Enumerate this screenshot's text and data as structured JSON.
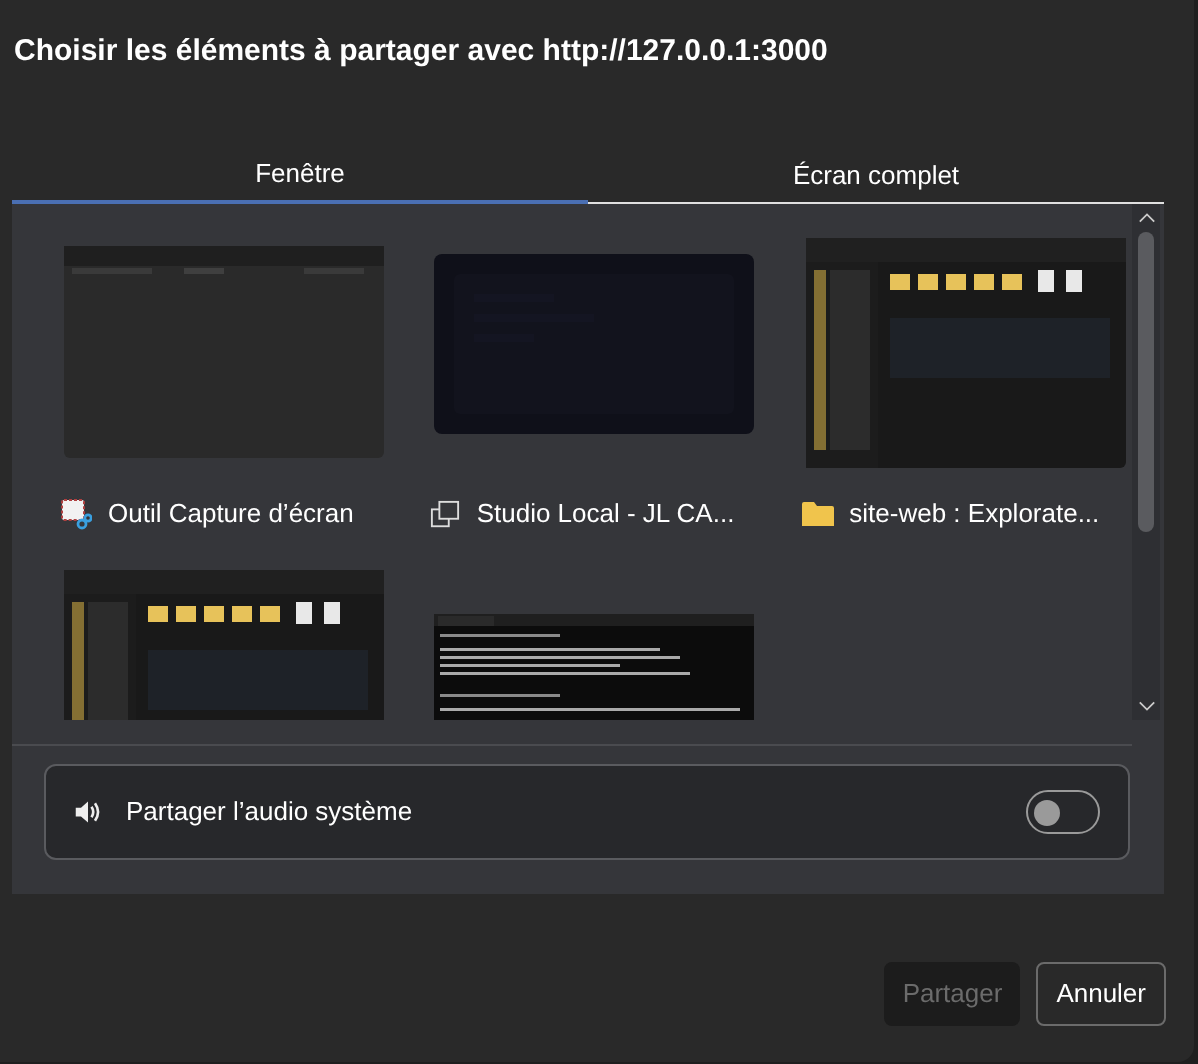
{
  "dialog": {
    "title": "Choisir les éléments à partager avec http://127.0.0.1:3000"
  },
  "tabs": [
    {
      "label": "Fenêtre",
      "selected": true
    },
    {
      "label": "Écran complet",
      "selected": false
    }
  ],
  "sources": [
    {
      "label": "Outil Capture d’écran",
      "kind": "snip",
      "selected": false
    },
    {
      "label": "Studio Local - JL CA...",
      "kind": "window",
      "selected": false
    },
    {
      "label": "site-web : Explorate...",
      "kind": "folder",
      "selected": false
    },
    {
      "kind": "explorer",
      "selected": false
    },
    {
      "kind": "terminal",
      "selected": false
    }
  ],
  "audio": {
    "label": "Partager l’audio système",
    "on": false
  },
  "buttons": [
    {
      "label": "Partager",
      "disabled": true
    },
    {
      "label": "Annuler",
      "disabled": false
    }
  ]
}
